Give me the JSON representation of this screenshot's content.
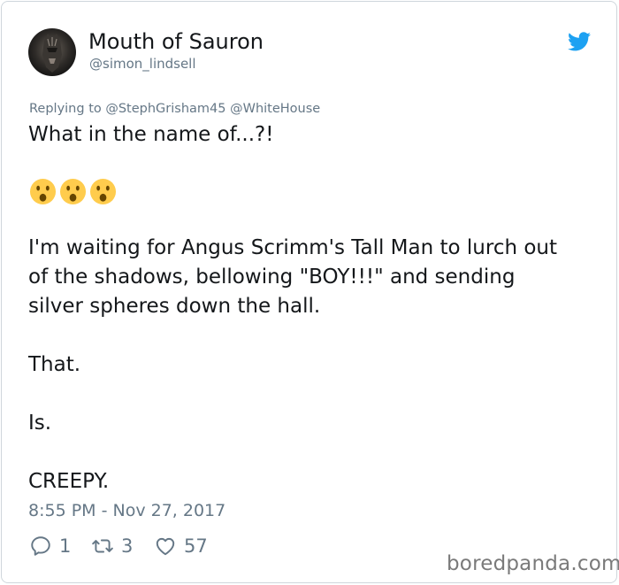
{
  "tweet": {
    "display_name": "Mouth of Sauron",
    "handle": "@simon_lindsell",
    "replying_to": "Replying to @StephGrisham45 @WhiteHouse",
    "lines": [
      "What in the name of...?!",
      "I'm waiting for Angus Scrimm's Tall Man to lurch out",
      "of the shadows, bellowing \"BOY!!!\" and sending",
      "silver spheres down the hall.",
      "That.",
      "Is.",
      "CREEPY."
    ],
    "emojis": [
      "hushed-face-emoji",
      "hushed-face-emoji",
      "hushed-face-emoji"
    ],
    "timestamp": "8:55 PM - Nov 27, 2017",
    "replies": "1",
    "retweets": "3",
    "likes": "57"
  },
  "watermark": "boredpanda.com",
  "colors": {
    "bird": "#1da1f2",
    "secondary_text": "#657786",
    "emoji_face": "#ffcc4d"
  }
}
